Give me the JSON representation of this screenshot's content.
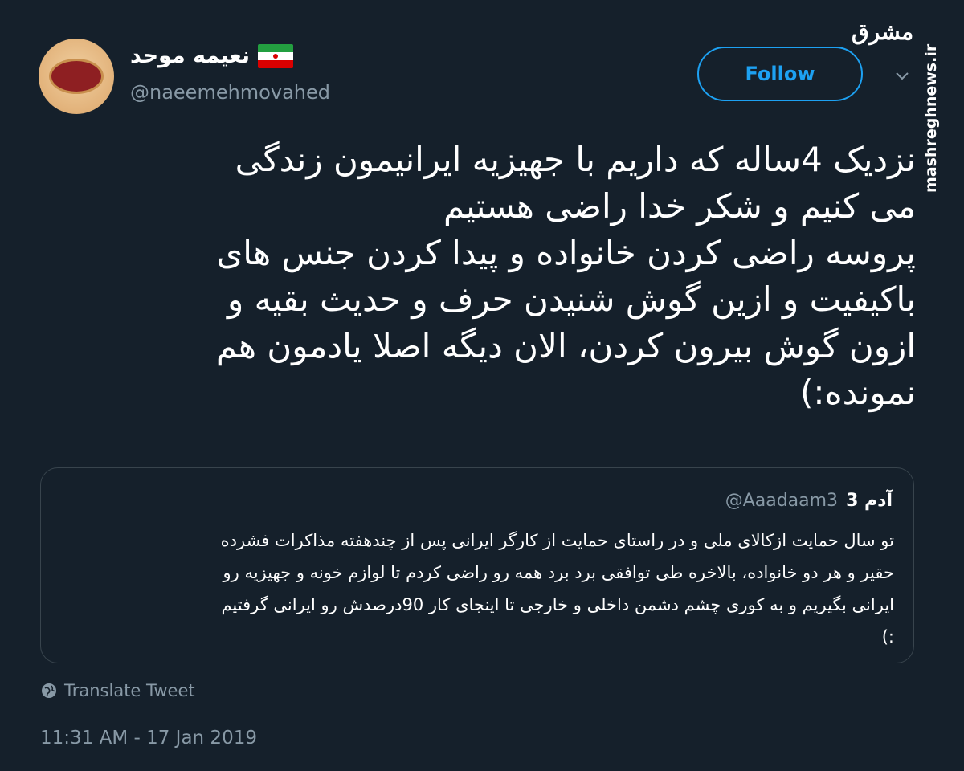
{
  "author": {
    "display_name": "نعیمه موحد",
    "handle": "@naeemehmovahed"
  },
  "follow_button": {
    "label": "Follow"
  },
  "watermark": {
    "logo": "مشرق",
    "site": "mashreghnews.ir"
  },
  "tweet": {
    "text": "نزدیک 4ساله که داریم با جهیزیه ایرانیمون زندگی\nمی کنیم و شکر خدا راضی هستیم\nپروسه راضی کردن خانواده و پیدا کردن جنس های\nباکیفیت و ازین گوش شنیدن حرف و حدیث بقیه و\nازون گوش بیرون کردن، الان دیگه اصلا یادمون هم\nنمونده:)"
  },
  "quoted_tweet": {
    "name": "آدم 3",
    "handle": "@Aaadaam3",
    "text": "تو سال حمایت ازکالای ملی و در راستای حمایت از کارگر ایرانی پس از چندهفته مذاکرات فشرده\nحقیر و هر دو خانواده، بالاخره طی توافقی برد برد همه رو راضی کردم تا لوازم خونه و جهیزیه رو\nایرانی بگیریم و به کوری چشم دشمن داخلی و خارجی تا اینجای کار 90درصدش رو ایرانی گرفتیم\n:)"
  },
  "translate": {
    "label": "Translate Tweet",
    "icon": "globe-icon"
  },
  "timestamp": "11:31 AM - 17 Jan 2019",
  "colors": {
    "background": "#15202b",
    "accent": "#1da1f2",
    "muted": "#8899a6",
    "border": "#38444d"
  }
}
